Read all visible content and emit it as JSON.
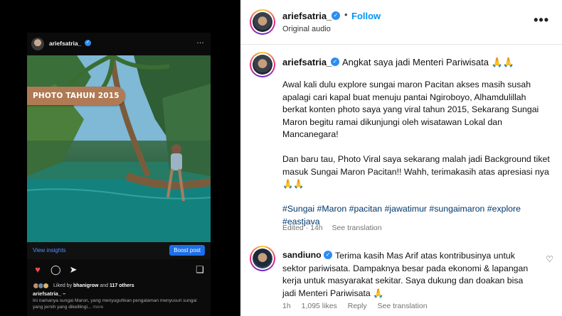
{
  "phone_post": {
    "username": "ariefsatria_",
    "more": "…",
    "photo_tag": "PHOTO TAHUN 2015",
    "view_insights": "View insights",
    "boost_post": "Boost post",
    "liked_by_prefix": "Liked by ",
    "liked_by_user": "bhanigrow",
    "liked_by_suffix": " and ",
    "liked_by_others": "117 others",
    "caption_user": "ariefsatria_",
    "caption_user_suffix": " –",
    "caption_text": "Ini namanya sungai Maron, yang menyuguhkan pengalaman menyusuri sungai yang jernih yang dikelilingi...",
    "caption_more": " more"
  },
  "header": {
    "username": "ariefsatria_",
    "separator": "•",
    "follow_label": "Follow",
    "audio_label": "Original audio",
    "more": "•••"
  },
  "caption": {
    "username": "ariefsatria_",
    "title": "Angkat saya jadi Menteri Pariwisata 🙏🙏",
    "paragraph1": "Awal kali dulu explore sungai maron Pacitan akses masih susah apalagi cari kapal buat menuju pantai Ngiroboyo, Alhamdulillah berkat konten photo saya yang viral tahun 2015, Sekarang Sungai Maron begitu ramai dikunjungi oleh wisatawan Lokal dan Mancanegara!",
    "paragraph2": "Dan baru tau, Photo Viral saya sekarang malah jadi Background tiket masuk Sungai Maron Pacitan!! Wahh, terimakasih atas apresiasi nya 🙏🙏",
    "hashtags": "#Sungai #Maron #pacitan #jawatimur #sungaimaron #explore #eastjava",
    "edited": "Edited · 14h",
    "see_translation": "See translation"
  },
  "comment": {
    "username": "sandiuno",
    "text": "Terima kasih Mas Arif atas kontribusinya untuk sektor pariwisata. Dampaknya besar pada ekonomi & lapangan kerja untuk masyarakat sekitar. Saya dukung dan doakan bisa jadi Menteri Pariwisata 🙏",
    "age": "1h",
    "likes": "1,095 likes",
    "reply": "Reply",
    "see_translation": "See translation"
  },
  "icons": {
    "like": "heart-icon",
    "comment": "comment-icon",
    "share": "share-icon",
    "save": "bookmark-icon",
    "verified": "verified-badge-icon",
    "comment_like": "heart-outline-icon"
  },
  "colors": {
    "accent": "#0095f6",
    "liked_heart": "#ed4956",
    "hashtag": "#00376b",
    "boost": "#1c6fe8",
    "photo_tag": "#b07a55"
  }
}
